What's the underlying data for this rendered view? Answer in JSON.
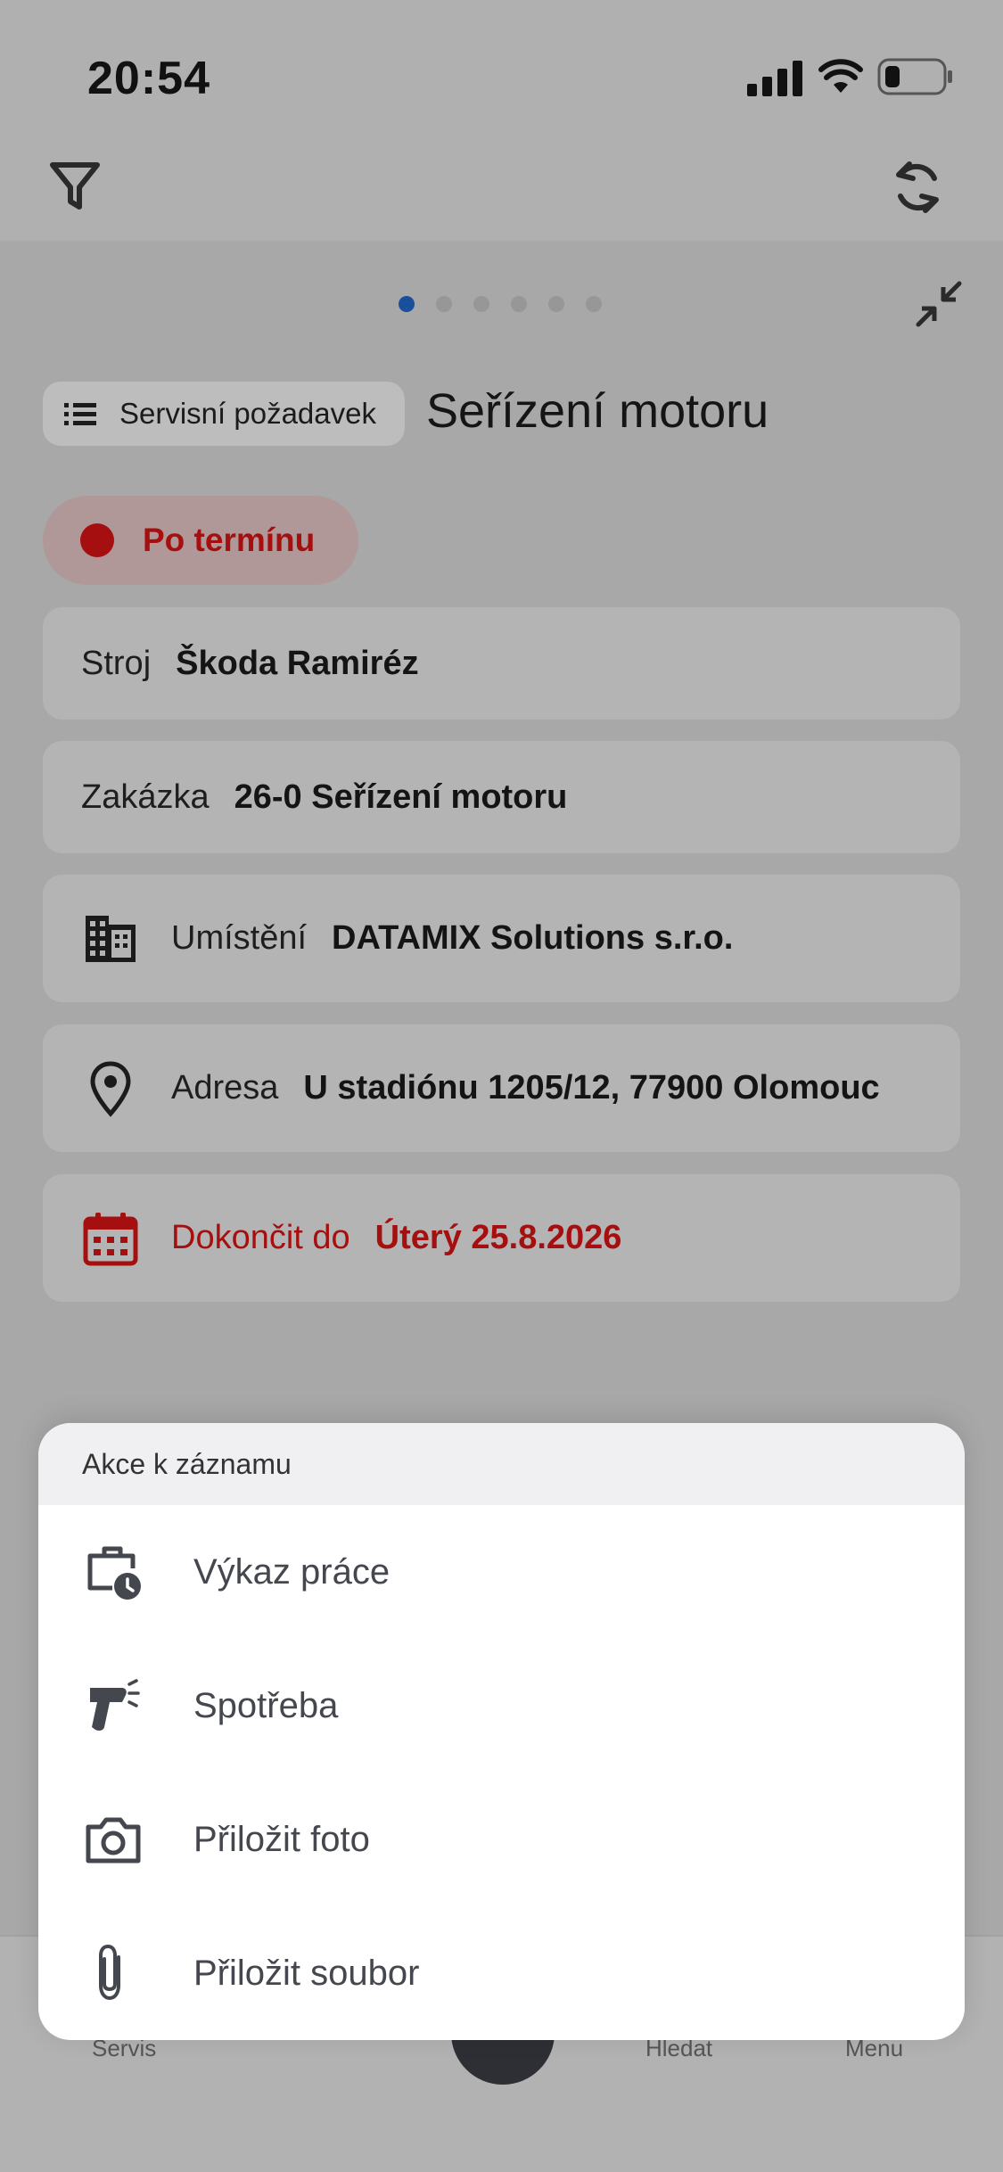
{
  "status_bar": {
    "time": "20:54"
  },
  "pager": {
    "count": 6,
    "active_index": 0
  },
  "record": {
    "type_label": "Servisní požadavek",
    "title": "Seřízení motoru",
    "status": "Po termínu"
  },
  "fields": {
    "machine": {
      "label": "Stroj",
      "value": "Škoda Ramiréz"
    },
    "order": {
      "label": "Zakázka",
      "value": "26-0 Seřízení motoru"
    },
    "location": {
      "label": "Umístění",
      "value": "DATAMIX Solutions s.r.o."
    },
    "address": {
      "label": "Adresa",
      "value": "U stadiónu 1205/12, 77900 Olomouc"
    },
    "due": {
      "label": "Dokončit do",
      "value": "Úterý 25.8.2026"
    }
  },
  "bottom_nav": {
    "service": "Servis",
    "search": "Hledat",
    "menu": "Menu"
  },
  "action_sheet": {
    "title": "Akce k záznamu",
    "actions": [
      {
        "label": "Výkaz práce",
        "icon": "briefcase-clock-icon"
      },
      {
        "label": "Spotřeba",
        "icon": "barcode-scanner-icon"
      },
      {
        "label": "Přiložit foto",
        "icon": "camera-icon"
      },
      {
        "label": "Přiložit soubor",
        "icon": "paperclip-icon"
      }
    ]
  },
  "colors": {
    "accent_blue": "#1a4f9c",
    "overdue_red": "#a50f0f",
    "scrim": "#a8a8a8"
  }
}
